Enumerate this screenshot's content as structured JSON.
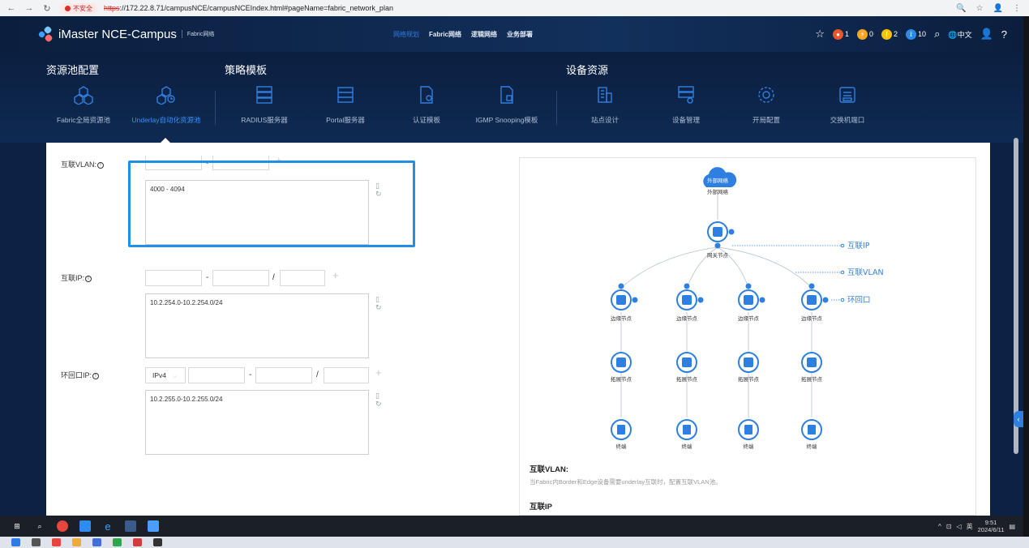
{
  "browser": {
    "insecure_label": "不安全",
    "url_scheme": "https",
    "url_rest": "://172.22.8.71/campusNCE/campusNCEIndex.html#pageName=fabric_network_plan",
    "icons": [
      "back-icon",
      "forward-icon",
      "reload-icon",
      "zoom-icon",
      "star-icon",
      "profile-icon",
      "menu-icon"
    ]
  },
  "header": {
    "brand": "iMaster NCE-Campus",
    "sub": "Fabric网络",
    "nav": [
      "网络规划",
      "Fabric网络",
      "逻辑网络",
      "业务部署"
    ],
    "active_nav": "网络规划",
    "alarms": [
      {
        "count": "1",
        "color": "#e8562a"
      },
      {
        "count": "0",
        "color": "#f5a623"
      },
      {
        "count": "2",
        "color": "#f7c300"
      },
      {
        "count": "10",
        "color": "#2e8ae6"
      }
    ],
    "lang": "中文"
  },
  "toolbar": {
    "groups": [
      {
        "title": "资源池配置"
      },
      {
        "title": "策略模板"
      },
      {
        "title": "设备资源"
      }
    ],
    "tiles": [
      {
        "label": "Fabric全局资源池",
        "icon": "resource-pool-icon",
        "active": false
      },
      {
        "label": "Underlay自动化资源池",
        "icon": "underlay-pool-icon",
        "active": true
      },
      {
        "label": "RADIUS服务器",
        "icon": "radius-server-icon",
        "active": false
      },
      {
        "label": "Portal服务器",
        "icon": "portal-server-icon",
        "active": false
      },
      {
        "label": "认证模板",
        "icon": "auth-template-icon",
        "active": false
      },
      {
        "label": "IGMP Snooping模板",
        "icon": "igmp-template-icon",
        "active": false
      },
      {
        "label": "站点设计",
        "icon": "site-design-icon",
        "active": false
      },
      {
        "label": "设备管理",
        "icon": "device-manage-icon",
        "active": false
      },
      {
        "label": "开局配置",
        "icon": "deploy-config-icon",
        "active": false
      },
      {
        "label": "交换机端口",
        "icon": "switch-port-icon",
        "active": false
      }
    ]
  },
  "form": {
    "vlan": {
      "label": "互联VLAN:",
      "range_sep": "-",
      "value": "4000 - 4094"
    },
    "ip": {
      "label": "互联IP:",
      "range_sep": "-",
      "mask_sep": "/",
      "value": "10.2.254.0-10.2.254.0/24"
    },
    "loopback": {
      "label": "环回口IP:",
      "family": "IPv4",
      "range_sep": "-",
      "mask_sep": "/",
      "value": "10.2.255.0-10.2.255.0/24"
    }
  },
  "diagram": {
    "cloud_icon_text": "外部网络",
    "cloud_label": "外部网络",
    "gateway_label": "网关节点",
    "edge_labels": [
      "边缘节点",
      "边缘节点",
      "边缘节点",
      "边缘节点"
    ],
    "topo_labels": [
      "拓展节点",
      "拓展节点",
      "拓展节点",
      "拓展节点"
    ],
    "terminal_labels": [
      "终端",
      "终端",
      "终端",
      "终端"
    ],
    "callouts": [
      "互联IP",
      "互联VLAN",
      "环回口"
    ],
    "colors": {
      "accent": "#2f7fe0",
      "node_fill": "#ffffff"
    }
  },
  "description": {
    "vlan_title": "互联VLAN:",
    "vlan_text": "当Fabric内Border和Edge设备需要underlay互联时，配置互联VLAN池。",
    "ip_title": "互联IP"
  },
  "taskbar": {
    "time": "9:51",
    "date": "2024/6/11",
    "ime": "英"
  }
}
